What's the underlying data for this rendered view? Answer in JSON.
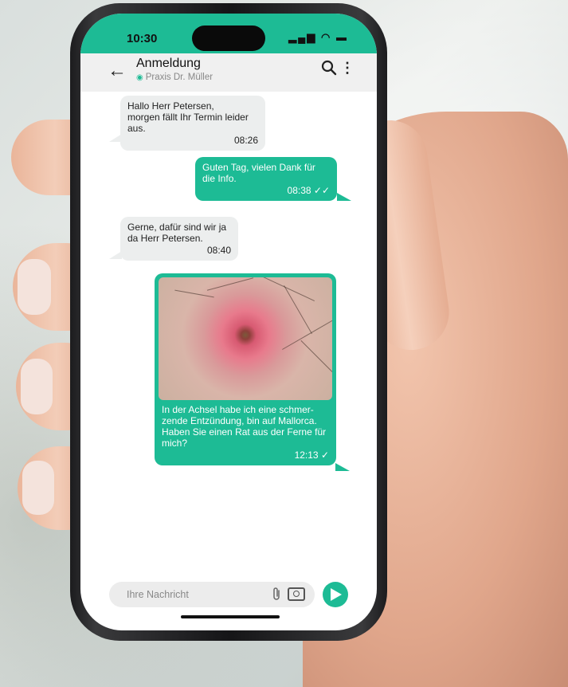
{
  "status_bar": {
    "time": "10:30"
  },
  "chat_header": {
    "title": "Anmeldung",
    "subtitle": "Praxis Dr. Müller"
  },
  "messages": [
    {
      "direction": "incoming",
      "text": "Hallo Herr Petersen,\nmorgen fällt Ihr Termin leider aus.",
      "time": "08:26"
    },
    {
      "direction": "outgoing",
      "text": "Guten Tag, vielen Dank für die Info.",
      "time": "08:38",
      "status": "read"
    },
    {
      "direction": "incoming",
      "text": "Gerne, dafür sind wir ja da Herr Petersen.",
      "time": "08:40"
    },
    {
      "direction": "outgoing",
      "text": "In der Achsel habe ich eine schmer-zende Entzündung, bin auf Mallorca. Haben Sie einen Rat aus der Ferne für mich?",
      "time": "12:13",
      "status": "sent",
      "has_image": true
    }
  ],
  "composer": {
    "placeholder": "Ihre Nachricht"
  },
  "colors": {
    "accent": "#1dbb95",
    "incoming_bubble": "#eceeee"
  },
  "icons": {
    "back": "arrow-left-icon",
    "search": "search-icon",
    "menu": "more-vertical-icon",
    "attach": "paperclip-icon",
    "camera": "camera-icon",
    "send": "send-icon"
  }
}
